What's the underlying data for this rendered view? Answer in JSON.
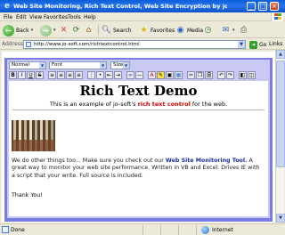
{
  "window": {
    "title": "Web Site Monitoring, Rich Text Control, Web Site Encryption by jo-soft.com - Microsof..."
  },
  "menu": [
    "File",
    "Edit",
    "View",
    "Favorites",
    "Tools",
    "Help"
  ],
  "toolbar": {
    "back_label": "Back",
    "search_label": "Search",
    "favorites_label": "Favorites",
    "media_label": "Media"
  },
  "address": {
    "label": "Address",
    "url": "http://www.jo-soft.com/richtextcontrol.html",
    "go_label": "Go",
    "links_label": "Links"
  },
  "editor": {
    "style_select": "Normal",
    "font_select": "Font",
    "size_select": "Size",
    "format_buttons": [
      "B",
      "I",
      "U",
      "S"
    ],
    "heading": "Rich Text Demo",
    "intro_before": "This is an example of jo-soft's",
    "intro_highlight": "rich text control",
    "intro_after": "for the web.",
    "para_before": "We do other things too... Make sure you check out our",
    "para_link": "Web Site Monitoring Tool.",
    "para_after": "A great way to monitor your web site performance. Written in VB and Excel. Drives IE with a script that your write. Full source is included.",
    "thanks": "Thank You!"
  },
  "status": {
    "text": "Done",
    "zone": "Internet"
  },
  "colors": {
    "editor_border": "#7b7be6",
    "editor_toolbar": "#c9c9f4",
    "highlight_red": "#d00000",
    "link_blue": "#1a2e9c"
  }
}
